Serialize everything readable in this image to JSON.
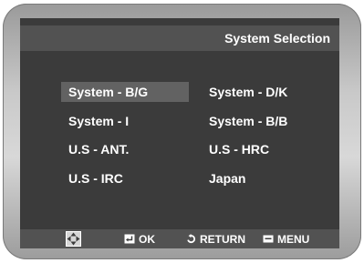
{
  "header": {
    "title": "System Selection"
  },
  "systems": {
    "left": [
      "System - B/G",
      "System - I",
      "U.S - ANT.",
      "U.S - IRC"
    ],
    "right": [
      "System - D/K",
      "System - B/B",
      "U.S - HRC",
      "Japan"
    ],
    "selected": "System - B/G"
  },
  "footer": {
    "ok_label": "OK",
    "return_label": "RETURN",
    "menu_label": "MENU"
  },
  "colors": {
    "screen_bg": "#3b3b3b",
    "bar_bg": "#525252",
    "highlight_bg": "#626262",
    "text": "#ffffff"
  },
  "icons": {
    "navigate": "four-way-arrows-icon",
    "ok": "enter-key-icon",
    "return": "return-arrow-icon",
    "menu": "menu-button-icon"
  }
}
